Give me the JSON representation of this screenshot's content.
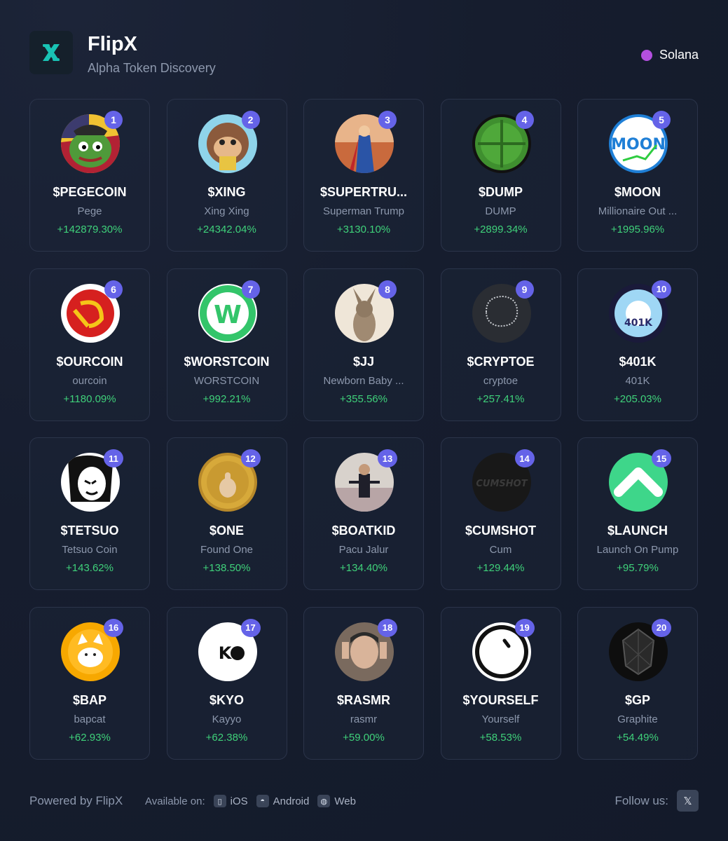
{
  "header": {
    "title": "FlipX",
    "subtitle": "Alpha Token Discovery",
    "network": "Solana",
    "logo_icon": "x-logo-icon",
    "accent_color": "#19c3b4",
    "network_color": "#b44fe0"
  },
  "tokens": [
    {
      "rank": "1",
      "ticker": "$PEGECOIN",
      "name": "Pege",
      "change": "+142879.30%",
      "icon": "pepe-frog-avatar"
    },
    {
      "rank": "2",
      "ticker": "$XING",
      "name": "Xing Xing",
      "change": "+24342.04%",
      "icon": "monkey-avatar"
    },
    {
      "rank": "3",
      "ticker": "$SUPERTRU...",
      "name": "Superman Trump",
      "change": "+3130.10%",
      "icon": "superhero-avatar"
    },
    {
      "rank": "4",
      "ticker": "$DUMP",
      "name": "DUMP",
      "change": "+2899.34%",
      "icon": "green-pill-avatar"
    },
    {
      "rank": "5",
      "ticker": "$MOON",
      "name": "Millionaire Out ...",
      "change": "+1995.96%",
      "icon": "moon-text-avatar"
    },
    {
      "rank": "6",
      "ticker": "$OURCOIN",
      "name": "ourcoin",
      "change": "+1180.09%",
      "icon": "hammer-sickle-avatar"
    },
    {
      "rank": "7",
      "ticker": "$WORSTCOIN",
      "name": "WORSTCOIN",
      "change": "+992.21%",
      "icon": "w-letter-avatar"
    },
    {
      "rank": "8",
      "ticker": "$JJ",
      "name": "Newborn Baby ...",
      "change": "+355.56%",
      "icon": "baby-kangaroo-avatar"
    },
    {
      "rank": "9",
      "ticker": "$CRYPTOE",
      "name": "cryptoe",
      "change": "+257.41%",
      "icon": "ascii-foot-avatar"
    },
    {
      "rank": "10",
      "ticker": "$401K",
      "name": "401K",
      "change": "+205.03%",
      "icon": "401k-burst-avatar"
    },
    {
      "rank": "11",
      "ticker": "$TETSUO",
      "name": "Tetsuo Coin",
      "change": "+143.62%",
      "icon": "manga-face-avatar"
    },
    {
      "rank": "12",
      "ticker": "$ONE",
      "name": "Found One",
      "change": "+138.50%",
      "icon": "gold-coin-avatar"
    },
    {
      "rank": "13",
      "ticker": "$BOATKID",
      "name": "Pacu Jalur",
      "change": "+134.40%",
      "icon": "boat-kid-avatar"
    },
    {
      "rank": "14",
      "ticker": "$CUMSHOT",
      "name": "Cum",
      "change": "+129.44%",
      "icon": "dark-logo-avatar"
    },
    {
      "rank": "15",
      "ticker": "$LAUNCH",
      "name": "Launch On Pump",
      "change": "+95.79%",
      "icon": "launch-arrow-avatar"
    },
    {
      "rank": "16",
      "ticker": "$BAP",
      "name": "bapcat",
      "change": "+62.93%",
      "icon": "orange-cat-avatar"
    },
    {
      "rank": "17",
      "ticker": "$KYO",
      "name": "Kayyo",
      "change": "+62.38%",
      "icon": "kyo-logo-avatar"
    },
    {
      "rank": "18",
      "ticker": "$RASMR",
      "name": "rasmr",
      "change": "+59.00%",
      "icon": "man-photo-avatar"
    },
    {
      "rank": "19",
      "ticker": "$YOURSELF",
      "name": "Yourself",
      "change": "+58.53%",
      "icon": "clock-face-avatar"
    },
    {
      "rank": "20",
      "ticker": "$GP",
      "name": "Graphite",
      "change": "+54.49%",
      "icon": "graphite-crystal-avatar"
    }
  ],
  "footer": {
    "powered": "Powered by FlipX",
    "available": "Available on:",
    "platforms": [
      {
        "label": "iOS",
        "icon": "phone-icon"
      },
      {
        "label": "Android",
        "icon": "android-icon"
      },
      {
        "label": "Web",
        "icon": "globe-icon"
      }
    ],
    "follow": "Follow us:",
    "x_glyph": "𝕏"
  },
  "colors": {
    "positive": "#3fd17a",
    "rank_badge": "#6563e8",
    "muted_text": "#8d98ad"
  }
}
